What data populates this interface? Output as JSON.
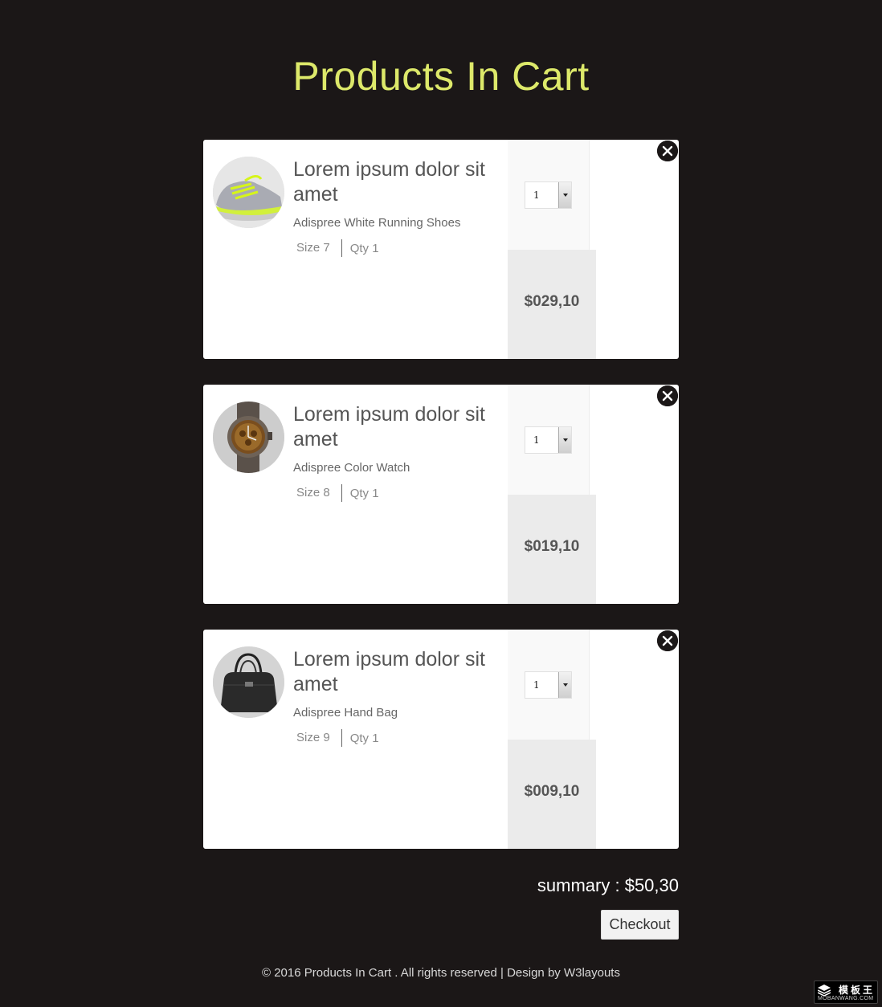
{
  "page": {
    "title": "Products In Cart",
    "background_color": "#1b1717",
    "title_color": "#dde96a"
  },
  "cart_items": [
    {
      "title": "Lorem ipsum dolor sit amet",
      "description": "Adispree White Running Shoes",
      "size": "Size 7",
      "qty": "Qty 1",
      "quantity_select": "1",
      "price": "$029,10",
      "image": "running-shoe-image"
    },
    {
      "title": "Lorem ipsum dolor sit amet",
      "description": "Adispree Color Watch",
      "size": "Size 8",
      "qty": "Qty 1",
      "quantity_select": "1",
      "price": "$019,10",
      "image": "wrist-watch-image"
    },
    {
      "title": "Lorem ipsum dolor sit amet",
      "description": "Adispree Hand Bag",
      "size": "Size 9",
      "qty": "Qty 1",
      "quantity_select": "1",
      "price": "$009,10",
      "image": "hand-bag-image"
    }
  ],
  "summary": {
    "text": "summary : $50,30"
  },
  "checkout": {
    "label": "Checkout"
  },
  "footer": {
    "text": "© 2016 Products In Cart . All rights reserved | Design by W3layouts"
  },
  "watermark": {
    "cn": "模板王",
    "en": "MOBANWANG.COM"
  }
}
